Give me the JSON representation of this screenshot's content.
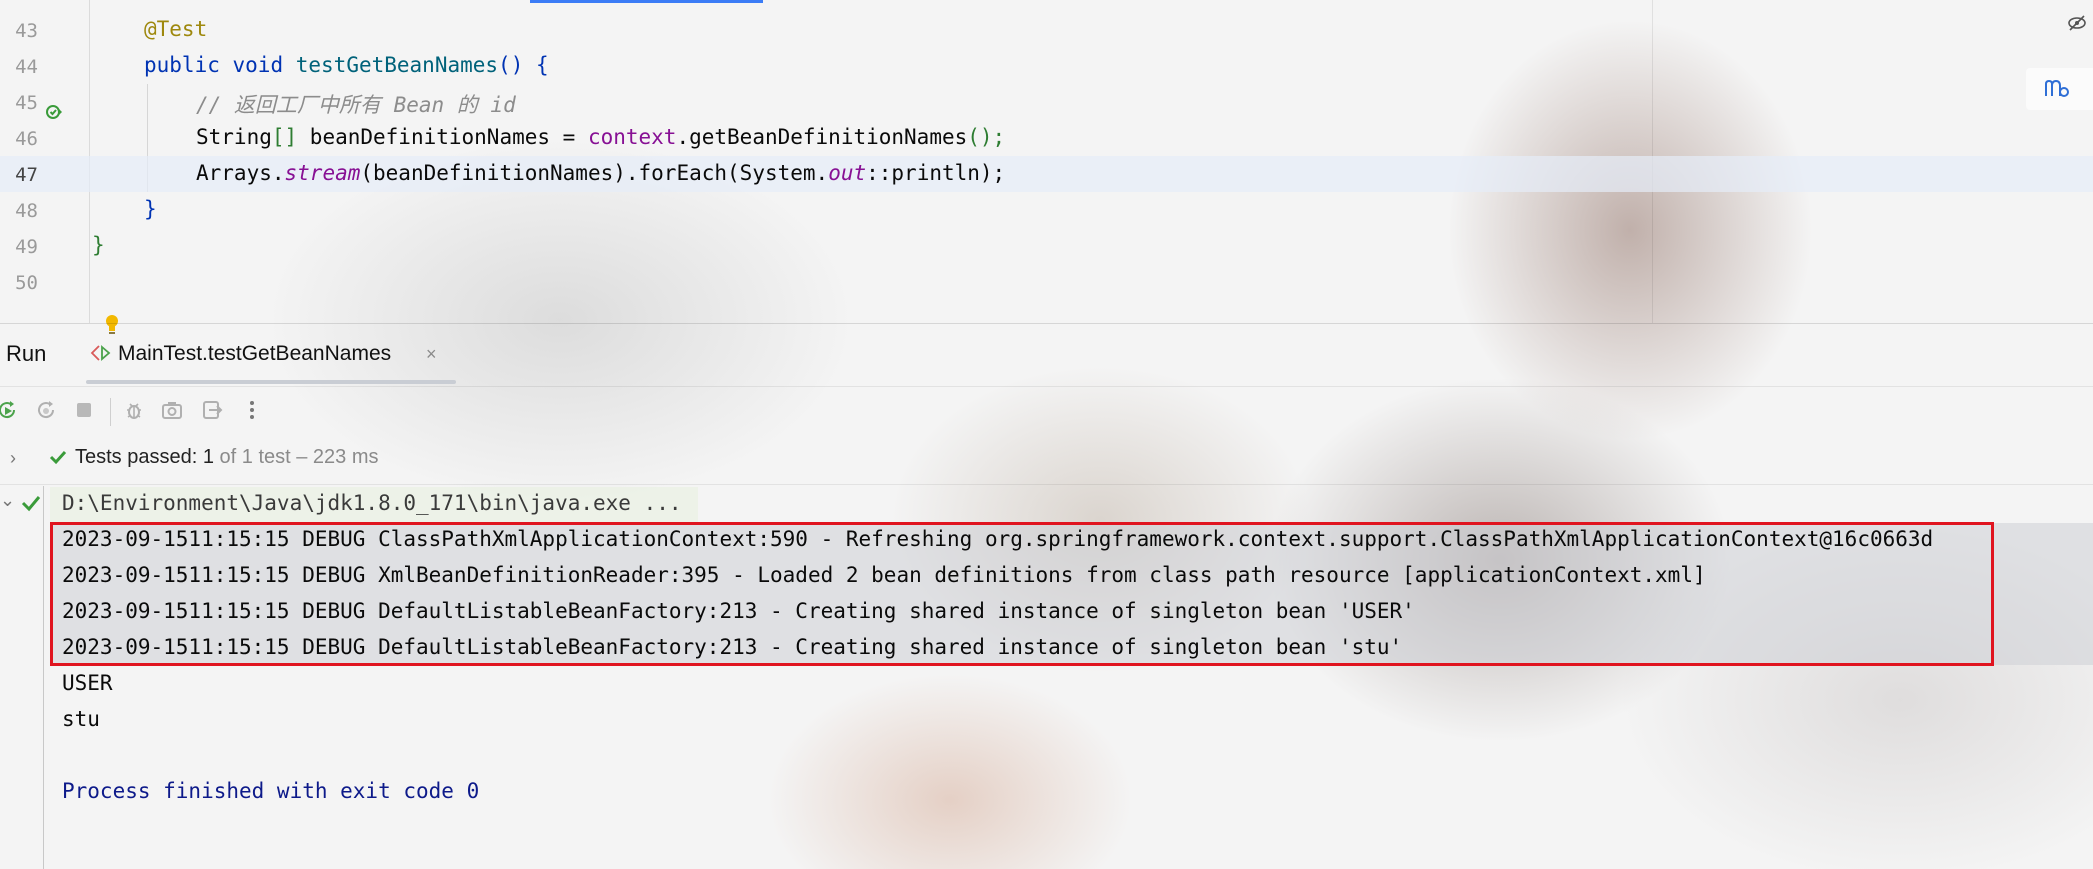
{
  "editor": {
    "lines": [
      {
        "num": "43"
      },
      {
        "num": "44"
      },
      {
        "num": "45"
      },
      {
        "num": "46"
      },
      {
        "num": "47"
      },
      {
        "num": "48"
      },
      {
        "num": "49"
      },
      {
        "num": "50"
      }
    ],
    "code": {
      "l43_annotation": "@Test",
      "l44_public": "public",
      "l44_void": "void",
      "l44_method": "testGetBeanNames",
      "l44_rest": "() {",
      "l45_comment": "// 返回工厂中所有 Bean 的 id",
      "l46_a": "String",
      "l46_b": "[]",
      "l46_c": " beanDefinitionNames = ",
      "l46_d": "context",
      "l46_e": ".getBeanDefinitionNames",
      "l46_f": "();",
      "l47_a": "Arrays.",
      "l47_b": "stream",
      "l47_c": "(beanDefinitionNames).forEach(",
      "l47_d": "System.",
      "l47_e": "out",
      "l47_f": "::println);",
      "l48": "}",
      "l49": "}"
    },
    "gutter_icons": [
      "run-test-icon",
      "lightbulb-icon"
    ]
  },
  "run_panel": {
    "title": "Run",
    "tab_label": "MainTest.testGetBeanNames",
    "tab_close": "×",
    "toolbar_icons": [
      "rerun-icon",
      "rerun-failed-icon",
      "stop-icon",
      "debug-icon",
      "screenshot-icon",
      "export-icon",
      "more-icon"
    ],
    "status": {
      "passed_label": "Tests passed: ",
      "passed_count": "1",
      "detail": " of 1 test – 223 ms"
    }
  },
  "console": {
    "command": "D:\\Environment\\Java\\jdk1.8.0_171\\bin\\java.exe ...",
    "debug_lines": [
      "2023-09-1511:15:15 DEBUG ClassPathXmlApplicationContext:590 - Refreshing org.springframework.context.support.ClassPathXmlApplicationContext@16c0663d",
      "2023-09-1511:15:15 DEBUG XmlBeanDefinitionReader:395 - Loaded 2 bean definitions from class path resource [applicationContext.xml]",
      "2023-09-1511:15:15 DEBUG DefaultListableBeanFactory:213 - Creating shared instance of singleton bean 'USER'",
      "2023-09-1511:15:15 DEBUG DefaultListableBeanFactory:213 - Creating shared instance of singleton bean 'stu'"
    ],
    "output_lines": [
      "USER",
      "stu"
    ],
    "exit": "Process finished with exit code 0"
  },
  "colors": {
    "highlight_box": "#e0141f",
    "keyword": "#0033b3",
    "annotation": "#9e880d",
    "field": "#871094",
    "success": "#3a9b3a"
  }
}
